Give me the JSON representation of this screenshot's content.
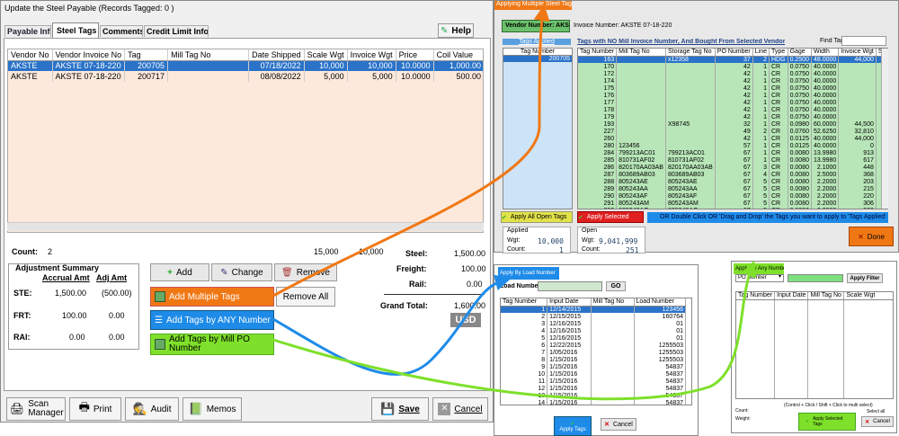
{
  "main": {
    "title": "Update the Steel Payable  (Records Tagged:  0 )",
    "tabs": [
      "Payable Info",
      "Steel Tags",
      "Comments",
      "Credit Limit Info"
    ],
    "help": "Help",
    "columns": [
      "Vendor No",
      "Vendor Invoice No",
      "Tag",
      "Mill Tag No",
      "Date Shipped",
      "Scale Wgt",
      "Invoice Wgt",
      "Price",
      "Coil Value"
    ],
    "rows": [
      [
        "AKSTE",
        "AKSTE 07-18-220",
        "200705",
        "",
        "07/18/2022",
        "10,000",
        "10,000",
        "10.0000",
        "1,000.00"
      ],
      [
        "AKSTE",
        "AKSTE 07-18-220",
        "200717",
        "",
        "08/08/2022",
        "5,000",
        "5,000",
        "10.0000",
        "500.00"
      ]
    ],
    "count_label": "Count:",
    "count": "2",
    "total_scale": "15,000",
    "total_invoice": "10,000",
    "summary_title": "Adjustment Summary",
    "accrual_hdr": "Accrual Amt",
    "adj_hdr": "Adj Amt",
    "summary": [
      {
        "label": "STE:",
        "accrual": "1,500.00",
        "adj": "(500.00)"
      },
      {
        "label": "FRT:",
        "accrual": "100.00",
        "adj": "0.00"
      },
      {
        "label": "RAI:",
        "accrual": "0.00",
        "adj": "0.00"
      }
    ],
    "add": "Add",
    "change": "Change",
    "remove": "Remove",
    "remove_all": "Remove All",
    "add_multiple": "Add Multiple Tags",
    "add_any": "Add Tags by ANY Number",
    "add_mill": "Add Tags by Mill PO Number",
    "totals": [
      {
        "label": "Steel:",
        "value": "1,500.00"
      },
      {
        "label": "Freight:",
        "value": "100.00"
      },
      {
        "label": "Rail:",
        "value": "0.00"
      }
    ],
    "grand_label": "Grand Total:",
    "grand_value": "1,600.00",
    "currency": "USD",
    "bottom": [
      "Scan Manager",
      "Print",
      "Audit",
      "Memos"
    ],
    "save": "Save",
    "cancel": "Cancel"
  },
  "multi": {
    "title": "Applying Multiple Steel Tags",
    "vendor": "Vendor Number: AKSTE",
    "invoice": "Invoice Number: AKSTE 07-18-220",
    "tags_applied": "Tags Applied",
    "heading": "Tags with NO Mill Invoice Number, And Bought From Selected Vendor",
    "find": "Find Tag:",
    "left_hdr": "Tag Number",
    "left_sel": "200705",
    "cols": [
      "Tag Number",
      "Mill Tag No",
      "Storage Tag No",
      "PO Number",
      "Line",
      "Type",
      "Gage",
      "Width",
      "Invoice Wgt",
      "Scale W"
    ],
    "rows": [
      [
        "163",
        "",
        "x12358",
        "37",
        "2",
        "HDG",
        "0.2500",
        "48.0000",
        "44,000",
        "43,980"
      ],
      [
        "170",
        "",
        "",
        "42",
        "1",
        "CR",
        "0.0750",
        "40.0000",
        "",
        "0"
      ],
      [
        "172",
        "",
        "",
        "42",
        "1",
        "CR",
        "0.0750",
        "40.0000",
        "",
        "0"
      ],
      [
        "174",
        "",
        "",
        "42",
        "1",
        "CR",
        "0.0750",
        "40.0000",
        "",
        "0"
      ],
      [
        "175",
        "",
        "",
        "42",
        "1",
        "CR",
        "0.0750",
        "40.0000",
        "",
        "0"
      ],
      [
        "176",
        "",
        "",
        "42",
        "1",
        "CR",
        "0.0750",
        "40.0000",
        "",
        "0"
      ],
      [
        "177",
        "",
        "",
        "42",
        "1",
        "CR",
        "0.0750",
        "40.0000",
        "",
        "0"
      ],
      [
        "178",
        "",
        "",
        "42",
        "1",
        "CR",
        "0.0750",
        "40.0000",
        "",
        "0"
      ],
      [
        "179",
        "",
        "",
        "42",
        "1",
        "CR",
        "0.0750",
        "40.0000",
        "",
        "0"
      ],
      [
        "193",
        "",
        "X98745",
        "32",
        "1",
        "CR",
        "0.0980",
        "60.0000",
        "44,500",
        "44,500"
      ],
      [
        "227",
        "",
        "",
        "49",
        "2",
        "CR",
        "0.0760",
        "52.6250",
        "32,810",
        "32,810"
      ],
      [
        "260",
        "",
        "",
        "42",
        "1",
        "CR",
        "0.0125",
        "40.0000",
        "44,000",
        "44,000"
      ],
      [
        "280",
        "123456",
        "",
        "57",
        "1",
        "CR",
        "0.0125",
        "40.0000",
        "0",
        "0"
      ],
      [
        "284",
        "799213AC01",
        "799213AC01",
        "67",
        "1",
        "CR",
        "0.0080",
        "13.9980",
        "913",
        "913"
      ],
      [
        "285",
        "810731AF02",
        "810731AF02",
        "67",
        "1",
        "CR",
        "0.0080",
        "13.9980",
        "617",
        "617"
      ],
      [
        "286",
        "820170AA03AB",
        "820170AA03AB",
        "67",
        "3",
        "CR",
        "0.0080",
        "2.1000",
        "448",
        "448"
      ],
      [
        "287",
        "803689AB03",
        "803689AB03",
        "67",
        "4",
        "CR",
        "0.0080",
        "2.5000",
        "368",
        "368"
      ],
      [
        "288",
        "805243AE",
        "805243AE",
        "67",
        "5",
        "CR",
        "0.0080",
        "2.2000",
        "203",
        "203"
      ],
      [
        "289",
        "805243AA",
        "805243AA",
        "67",
        "5",
        "CR",
        "0.0080",
        "2.2000",
        "215",
        "215"
      ],
      [
        "290",
        "805243AF",
        "805243AF",
        "67",
        "5",
        "CR",
        "0.0080",
        "2.2000",
        "220",
        "220"
      ],
      [
        "291",
        "805243AM",
        "805243AM",
        "67",
        "5",
        "CR",
        "0.0080",
        "2.2000",
        "306",
        "306"
      ],
      [
        "292",
        "805243AO",
        "805243AO",
        "67",
        "5",
        "CR",
        "0.0080",
        "2.2000",
        "320",
        "320"
      ],
      [
        "293",
        "805243AQ",
        "805243AQ",
        "67",
        "5",
        "CR",
        "0.0080",
        "2.2000",
        "312",
        "312"
      ],
      [
        "294",
        "61984AAB02",
        "61984AAB02",
        "67",
        "1",
        "CR",
        "0.0080",
        "2.2000",
        "210",
        "210"
      ]
    ],
    "apply_all": "Apply All Open Tags",
    "apply_sel": "Apply Selected",
    "hint": "OR Double Click OR 'Drag and Drop' the Tags you want to apply to 'Tags Applied' box",
    "applied": "Applied",
    "open": "Open",
    "wgt": "Wgt:",
    "count": "Count:",
    "applied_wgt": "10,000",
    "applied_count": "1",
    "open_wgt": "9,041,999",
    "open_count": "251",
    "done": "Done"
  },
  "load": {
    "title": "Apply By Load Number",
    "label": "Load Number:",
    "go": "GO",
    "cols": [
      "Tag Number",
      "Input Date",
      "Mill Tag No",
      "Load Number"
    ],
    "rows": [
      [
        "1",
        "12/14/2015",
        "",
        "123456"
      ],
      [
        "2",
        "12/15/2015",
        "",
        "160764"
      ],
      [
        "3",
        "12/16/2015",
        "",
        "01"
      ],
      [
        "4",
        "12/16/2015",
        "",
        "01"
      ],
      [
        "5",
        "12/16/2015",
        "",
        "01"
      ],
      [
        "6",
        "12/22/2015",
        "",
        "1255503"
      ],
      [
        "7",
        "1/05/2016",
        "",
        "1255503"
      ],
      [
        "8",
        "1/15/2016",
        "",
        "1255503"
      ],
      [
        "9",
        "1/15/2016",
        "",
        "54837"
      ],
      [
        "10",
        "1/15/2016",
        "",
        "54837"
      ],
      [
        "11",
        "1/15/2016",
        "",
        "54837"
      ],
      [
        "12",
        "1/15/2016",
        "",
        "54837"
      ],
      [
        "13",
        "1/15/2016",
        "",
        "54837"
      ],
      [
        "14",
        "1/15/2016",
        "",
        "54837"
      ],
      [
        "15",
        "1/15/2016",
        "",
        "54837"
      ],
      [
        "16",
        "1/15/2016",
        "",
        "54837"
      ],
      [
        "17",
        "1/15/2016",
        "",
        "54837"
      ]
    ],
    "apply": "Apply Tags",
    "cancel": "Cancel"
  },
  "any": {
    "title": "Apply By Any Number",
    "select": "PO Number",
    "apply_filter": "Apply Filter",
    "cols": [
      "Tag Number",
      "Input Date",
      "Mill Tag No",
      "Scale Wgt"
    ],
    "note": "(Control + Click / Shift + Click to multi select)",
    "select_all": "Select all",
    "count": "Count:",
    "weight": "Weight:",
    "apply": "Apply Selected Tags",
    "cancel": "Cancel"
  },
  "colors": {
    "orange": "#f07814",
    "blue": "#1e8be8",
    "green": "#7ee02a",
    "sel": "#2a73c9"
  }
}
